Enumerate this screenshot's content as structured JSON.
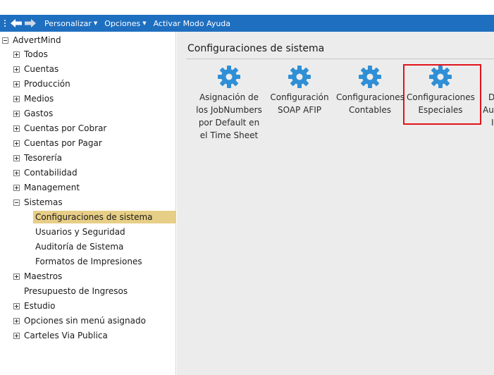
{
  "toolbar": {
    "back_icon": "back-arrow-icon",
    "forward_icon": "forward-arrow-icon",
    "menu": [
      {
        "label": "Personalizar",
        "has_caret": true
      },
      {
        "label": "Opciones",
        "has_caret": true
      },
      {
        "label": "Activar Modo Ayuda",
        "has_caret": false
      }
    ],
    "color": "#1f6fc0"
  },
  "sidebar": {
    "root": "AdvertMind",
    "items": [
      {
        "label": "Todos",
        "expander": "plus"
      },
      {
        "label": "Cuentas",
        "expander": "plus"
      },
      {
        "label": "Producción",
        "expander": "plus"
      },
      {
        "label": "Medios",
        "expander": "plus"
      },
      {
        "label": "Gastos",
        "expander": "plus"
      },
      {
        "label": "Cuentas por Cobrar",
        "expander": "plus"
      },
      {
        "label": "Cuentas por Pagar",
        "expander": "plus"
      },
      {
        "label": "Tesorería",
        "expander": "plus"
      },
      {
        "label": "Contabilidad",
        "expander": "plus"
      },
      {
        "label": "Management",
        "expander": "plus"
      },
      {
        "label": "Sistemas",
        "expander": "minus"
      },
      {
        "label": "Configuraciones de sistema",
        "expander": "none",
        "selected": true
      },
      {
        "label": "Usuarios y Seguridad",
        "expander": "none"
      },
      {
        "label": "Auditoría de Sistema",
        "expander": "none"
      },
      {
        "label": "Formatos de Impresiones",
        "expander": "none"
      },
      {
        "label": "Maestros",
        "expander": "plus"
      },
      {
        "label": "Presupuesto de Ingresos",
        "expander": "none"
      },
      {
        "label": "Estudio",
        "expander": "plus"
      },
      {
        "label": "Opciones sin menú asignado",
        "expander": "plus"
      },
      {
        "label": "Carteles Via Publica",
        "expander": "plus"
      }
    ],
    "selected_color": "#e7ce86"
  },
  "main": {
    "title": "Configuraciones de sistema",
    "cards": [
      {
        "lines": [
          "Asignación de",
          "los JobNumbers",
          "por Default en",
          "el Time Sheet"
        ],
        "icon": "gear-icon"
      },
      {
        "lines": [
          "Configuración",
          "SOAP AFIP"
        ],
        "icon": "gear-icon"
      },
      {
        "lines": [
          "Configuraciones",
          "Contables"
        ],
        "icon": "gear-icon"
      },
      {
        "lines": [
          "Configuraciones",
          "Especiales"
        ],
        "icon": "gear-icon",
        "highlighted": true
      }
    ],
    "cut_off_card": {
      "lines": [
        "D",
        "Aut",
        "I"
      ]
    },
    "icon_color": "#2f8fd6",
    "highlight_color": "#e0141b"
  }
}
